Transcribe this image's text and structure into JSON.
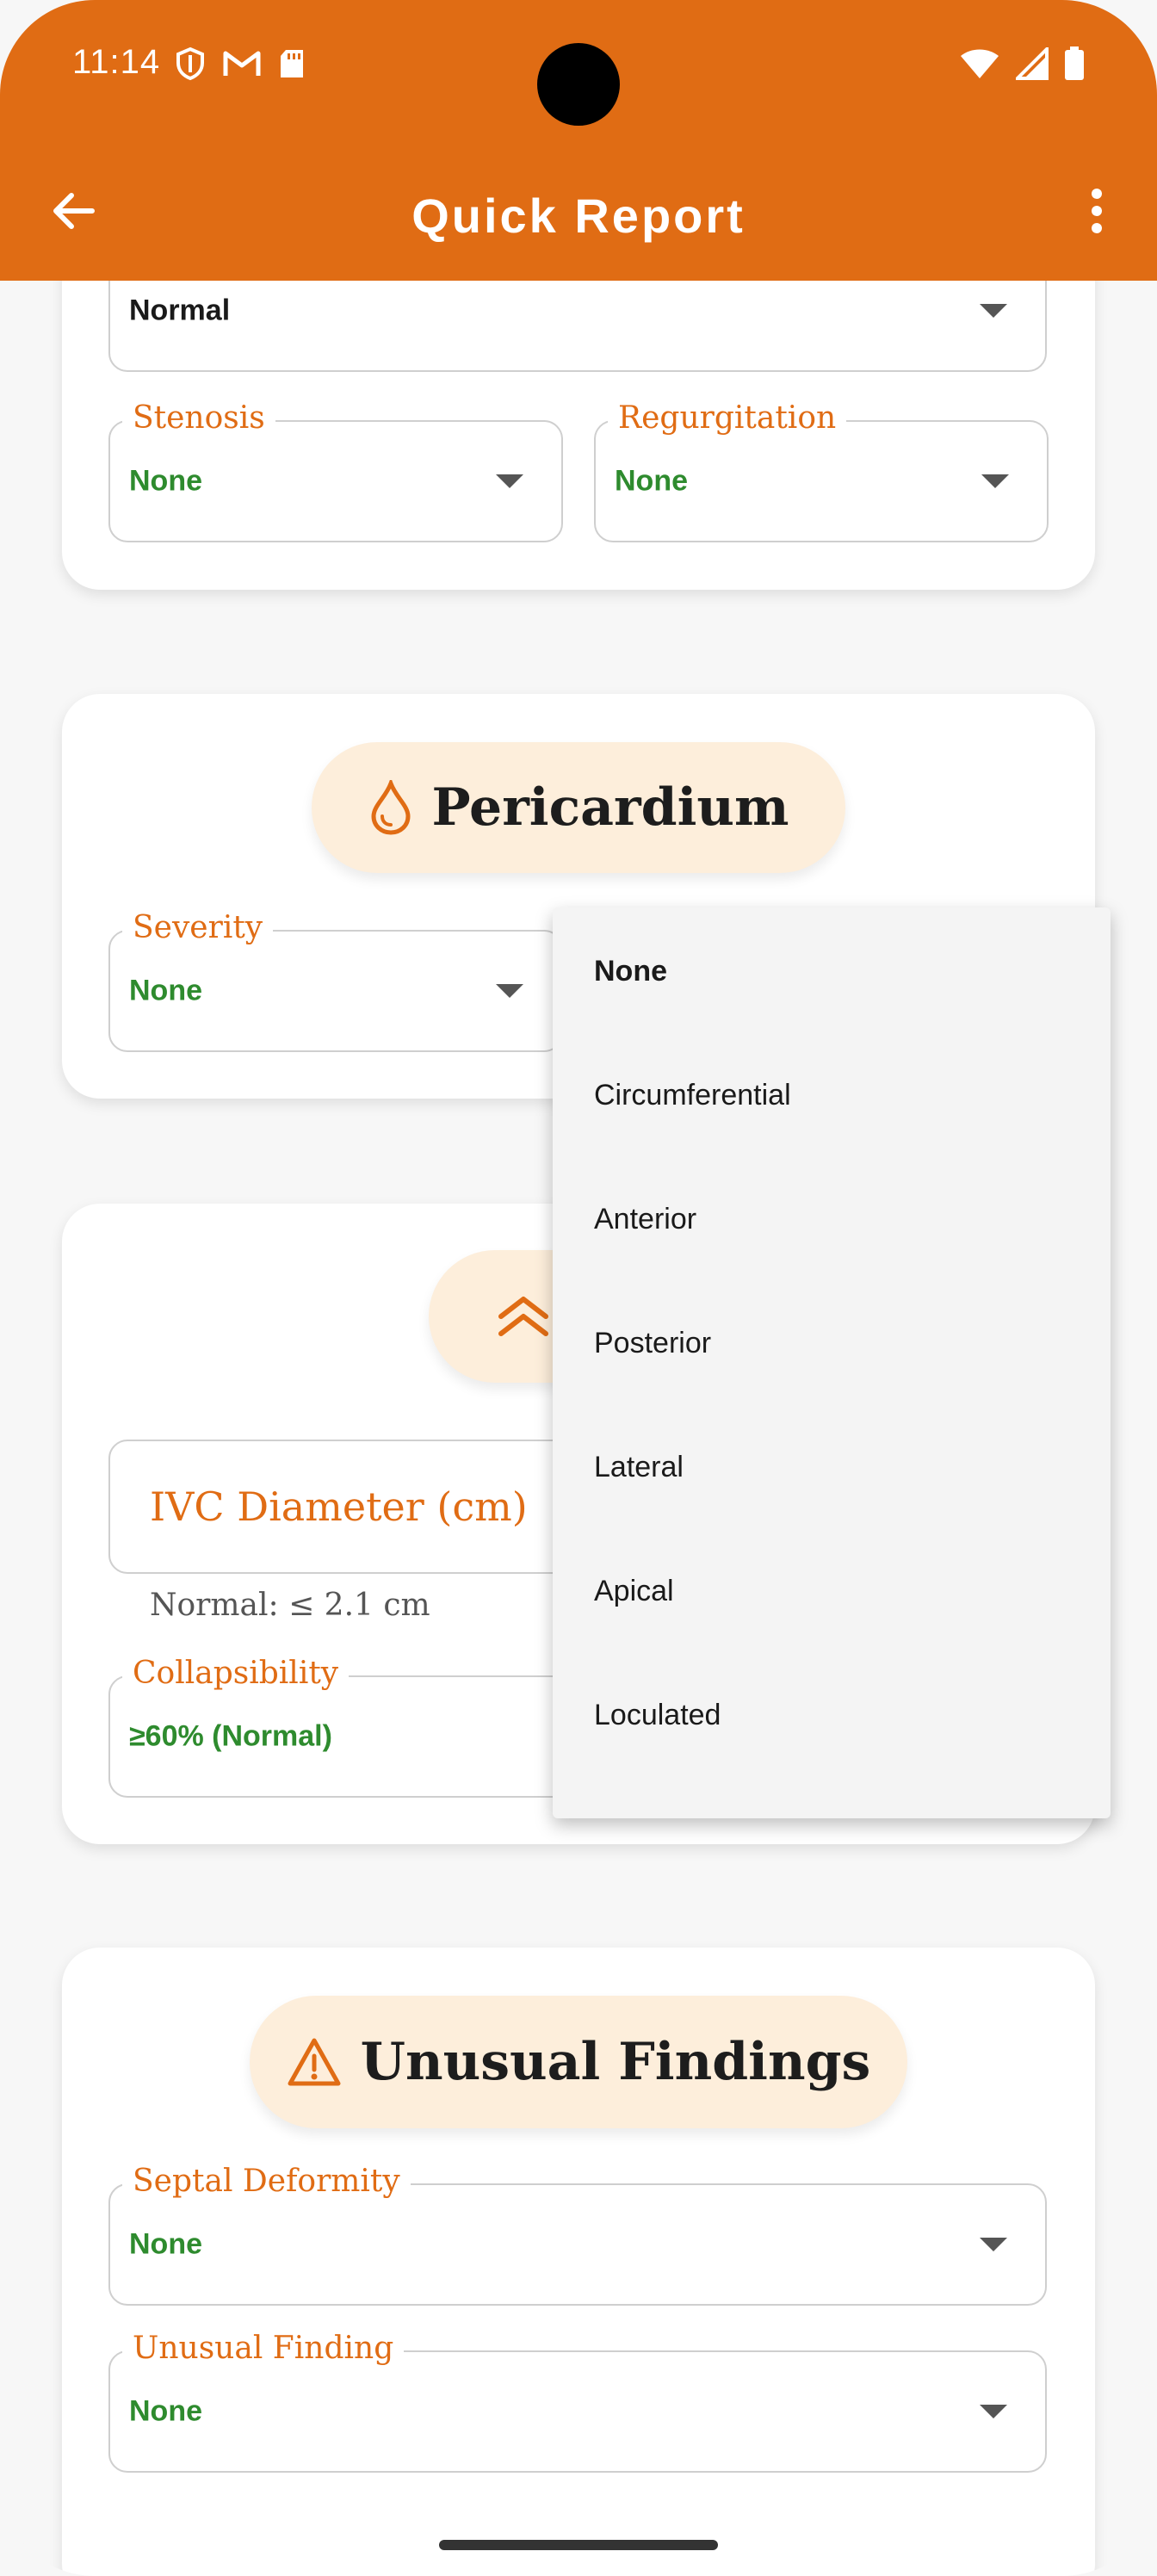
{
  "status_bar": {
    "time": "11:14"
  },
  "app_bar": {
    "title": "Quick Report"
  },
  "valve_card": {
    "top_value": "Normal",
    "stenosis": {
      "label": "Stenosis",
      "value": "None"
    },
    "regurgitation": {
      "label": "Regurgitation",
      "value": "None"
    }
  },
  "pericardium": {
    "title": "Pericardium",
    "severity": {
      "label": "Severity",
      "value": "None"
    }
  },
  "ivc": {
    "diameter_label": "IVC Diameter (cm)",
    "helper": "Normal: ≤ 2.1 cm",
    "collapsibility": {
      "label": "Collapsibility",
      "value": "≥60% (Normal)"
    }
  },
  "unusual": {
    "title": "Unusual Findings",
    "septal": {
      "label": "Septal Deformity",
      "value": "None"
    },
    "finding": {
      "label": "Unusual Finding",
      "value": "None"
    }
  },
  "dropdown_menu": {
    "options": [
      "None",
      "Circumferential",
      "Anterior",
      "Posterior",
      "Lateral",
      "Apical",
      "Loculated"
    ],
    "selected_index": 0
  },
  "colors": {
    "accent": "#e06c14",
    "pill_bg": "#fdeedb",
    "value_green": "#2e8b2e"
  },
  "icons": {
    "back": "arrow-left-icon",
    "more": "more-vert-icon",
    "pericardium": "droplet-icon",
    "ivc": "double-chevron-up-icon",
    "unusual": "warning-triangle-icon"
  }
}
